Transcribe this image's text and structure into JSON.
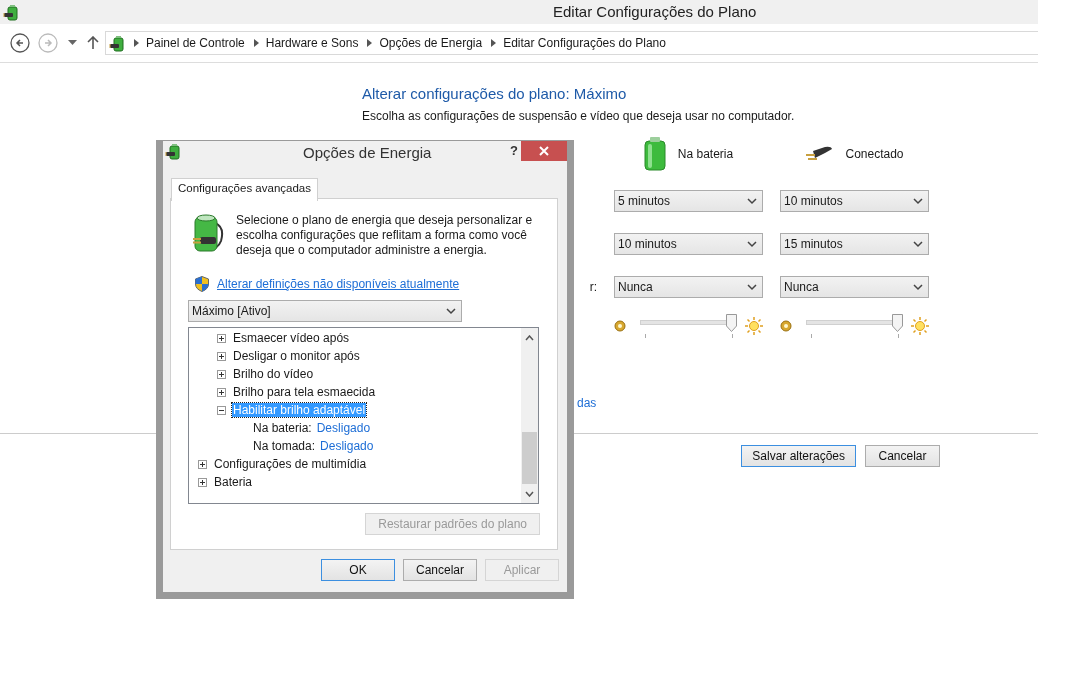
{
  "window": {
    "title": "Editar Configurações do Plano"
  },
  "nav": {
    "back": {
      "disabled": false
    },
    "forward": {
      "disabled": true
    },
    "breadcrumbs": [
      "Painel de Controle",
      "Hardware e Sons",
      "Opções de Energia",
      "Editar Configurações do Plano"
    ]
  },
  "plan": {
    "heading": "Alterar configurações do plano: Máximo",
    "subtitle": "Escolha as configurações de suspensão e vídeo que deseja usar no computador.",
    "columns": [
      {
        "kind": "battery",
        "label": "Na bateria"
      },
      {
        "kind": "plug",
        "label": "Conectado"
      }
    ],
    "rows": [
      {
        "kind": "select",
        "values": [
          "5 minutos",
          "10 minutos"
        ]
      },
      {
        "kind": "select",
        "values": [
          "10 minutos",
          "15 minutos"
        ]
      },
      {
        "kind": "select",
        "label": "r:",
        "values": [
          "Nunca",
          "Nunca"
        ]
      },
      {
        "kind": "slider",
        "sliders": [
          {
            "level": 1
          },
          {
            "level": 1
          }
        ]
      }
    ],
    "link": "das",
    "buttons": [
      {
        "label": "Salvar alterações",
        "focused": true
      },
      {
        "label": "Cancelar",
        "focused": false
      }
    ]
  },
  "dialog": {
    "title": "Opções de Energia",
    "help": "?",
    "tabs": [
      {
        "label": "Configurações avançadas",
        "selected": true
      }
    ],
    "description": "Selecione o plano de energia que deseja personalizar e escolha configurações que reflitam a forma como você deseja que o computador administre a energia.",
    "link": "Alterar definições não disponíveis atualmente",
    "plan_select": "Máximo [Ativo]",
    "tree": {
      "items": [
        {
          "children": [
            {
              "label": "Esmaecer vídeo após",
              "expanded": false,
              "selected": false
            },
            {
              "label": "Desligar o monitor após",
              "expanded": false,
              "selected": false
            },
            {
              "label": "Brilho do vídeo",
              "expanded": false,
              "selected": false
            },
            {
              "label": "Brilho para tela esmaecida",
              "expanded": false,
              "selected": false
            },
            {
              "label": "Habilitar brilho adaptável",
              "expanded": true,
              "selected": true,
              "settings": [
                {
                  "label": "Na bateria:",
                  "value": "Desligado"
                },
                {
                  "label": "Na tomada:",
                  "value": "Desligado"
                }
              ]
            }
          ]
        },
        {
          "label": "Configurações de multimídia",
          "expanded": false,
          "selected": false
        },
        {
          "label": "Bateria",
          "expanded": false,
          "selected": false
        }
      ]
    },
    "restore_button": {
      "label": "Restaurar padrões do plano",
      "disabled": true
    },
    "buttons": [
      {
        "label": "OK",
        "focused": true,
        "disabled": false
      },
      {
        "label": "Cancelar",
        "focused": false,
        "disabled": false
      },
      {
        "label": "Aplicar",
        "focused": false,
        "disabled": true
      }
    ]
  }
}
